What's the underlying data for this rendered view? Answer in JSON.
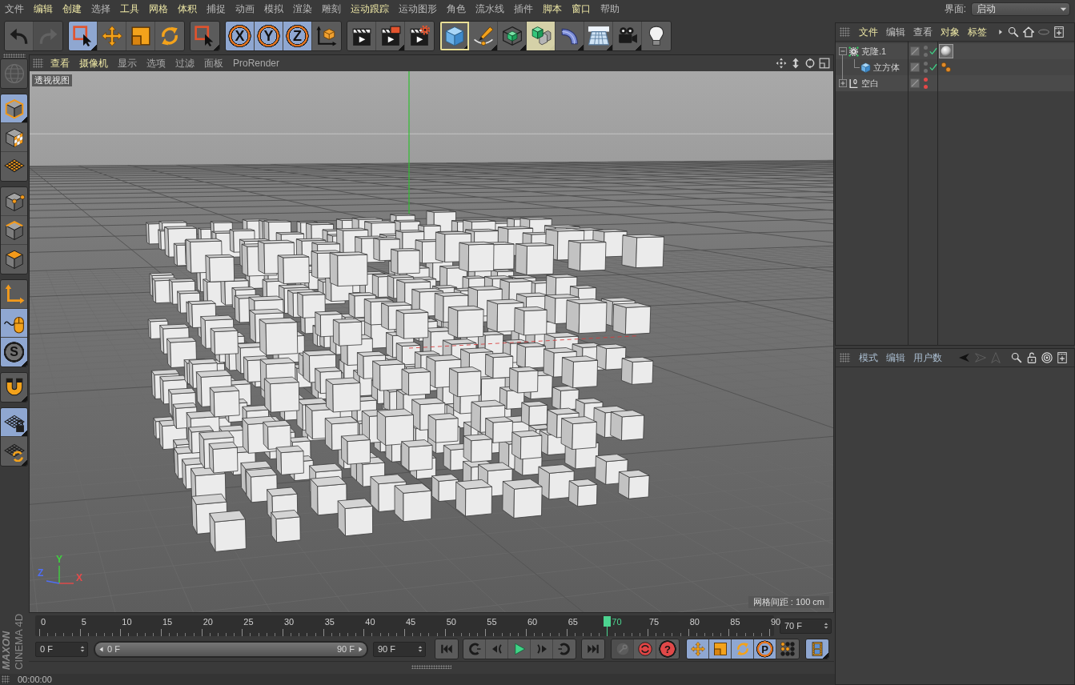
{
  "menu_bar": {
    "items": [
      {
        "label": "文件",
        "highlighted": false
      },
      {
        "label": "编辑",
        "highlighted": true
      },
      {
        "label": "创建",
        "highlighted": true
      },
      {
        "label": "选择",
        "highlighted": false
      },
      {
        "label": "工具",
        "highlighted": true
      },
      {
        "label": "网格",
        "highlighted": true
      },
      {
        "label": "体积",
        "highlighted": true
      },
      {
        "label": "捕捉",
        "highlighted": false
      },
      {
        "label": "动画",
        "highlighted": false
      },
      {
        "label": "模拟",
        "highlighted": false
      },
      {
        "label": "渲染",
        "highlighted": false
      },
      {
        "label": "雕刻",
        "highlighted": false
      },
      {
        "label": "运动跟踪",
        "highlighted": true
      },
      {
        "label": "运动图形",
        "highlighted": false
      },
      {
        "label": "角色",
        "highlighted": false
      },
      {
        "label": "流水线",
        "highlighted": false
      },
      {
        "label": "插件",
        "highlighted": false
      },
      {
        "label": "脚本",
        "highlighted": true
      },
      {
        "label": "窗口",
        "highlighted": true
      },
      {
        "label": "帮助",
        "highlighted": false
      }
    ],
    "layout_label": "界面:",
    "layout_dropdown": "启动"
  },
  "toolbar": {
    "groups": [
      {
        "buttons": [
          {
            "selected": false,
            "disabled": false,
            "focused": false,
            "highlighted": false
          },
          {
            "selected": false,
            "disabled": true,
            "focused": false,
            "highlighted": false
          }
        ]
      },
      {
        "buttons": [
          {
            "selected": true,
            "disabled": false,
            "focused": false,
            "highlighted": false
          },
          {
            "selected": false,
            "disabled": false,
            "focused": false,
            "highlighted": false
          },
          {
            "selected": false,
            "disabled": false,
            "focused": false,
            "highlighted": false
          },
          {
            "selected": false,
            "disabled": false,
            "focused": false,
            "highlighted": false
          }
        ]
      },
      {
        "buttons": [
          {
            "selected": false,
            "disabled": false,
            "focused": false,
            "highlighted": false
          }
        ]
      },
      {
        "buttons": [
          {
            "label": "X",
            "selected": true,
            "disabled": false,
            "focused": false,
            "highlighted": false
          },
          {
            "label": "Y",
            "selected": true,
            "disabled": false,
            "focused": false,
            "highlighted": false
          },
          {
            "label": "Z",
            "selected": true,
            "disabled": false,
            "focused": false,
            "highlighted": false
          },
          {
            "selected": false,
            "disabled": false,
            "focused": false,
            "highlighted": false
          }
        ]
      },
      {
        "buttons": [
          {
            "selected": false,
            "disabled": false,
            "focused": false,
            "highlighted": false
          },
          {
            "selected": false,
            "disabled": false,
            "focused": false,
            "highlighted": false
          },
          {
            "selected": false,
            "disabled": false,
            "focused": false,
            "highlighted": false
          }
        ]
      },
      {
        "buttons": [
          {
            "selected": false,
            "disabled": false,
            "focused": true,
            "highlighted": false
          },
          {
            "selected": false,
            "disabled": false,
            "focused": false,
            "highlighted": false
          },
          {
            "selected": false,
            "disabled": false,
            "focused": false,
            "highlighted": false
          },
          {
            "selected": false,
            "disabled": false,
            "focused": false,
            "highlighted": true
          },
          {
            "selected": false,
            "disabled": false,
            "focused": false,
            "highlighted": false
          },
          {
            "selected": false,
            "disabled": false,
            "focused": false,
            "highlighted": false
          },
          {
            "selected": false,
            "disabled": false,
            "focused": false,
            "highlighted": false
          },
          {
            "selected": false,
            "disabled": false,
            "focused": false,
            "highlighted": false
          }
        ]
      }
    ]
  },
  "left_toolbar": {
    "groups": [
      {
        "buttons": [
          {
            "selected": false,
            "disabled": true
          }
        ]
      },
      {
        "buttons": [
          {
            "selected": true,
            "disabled": false
          },
          {
            "selected": false,
            "disabled": false
          },
          {
            "selected": false,
            "disabled": false
          }
        ]
      },
      {
        "buttons": [
          {
            "selected": false,
            "disabled": false
          },
          {
            "selected": false,
            "disabled": false
          },
          {
            "selected": false,
            "disabled": false
          }
        ]
      },
      {
        "buttons": [
          {
            "selected": false,
            "disabled": false
          },
          {
            "selected": true,
            "disabled": false
          },
          {
            "label": "S",
            "selected": true,
            "disabled": false
          }
        ]
      },
      {
        "buttons": [
          {
            "selected": false,
            "disabled": false
          }
        ]
      },
      {
        "buttons": [
          {
            "selected": true,
            "disabled": false
          },
          {
            "selected": false,
            "disabled": false
          }
        ]
      }
    ]
  },
  "logo": {
    "brand": "MAXON",
    "product": "CINEMA 4D"
  },
  "viewport": {
    "menu": [
      {
        "label": "查看",
        "highlighted": true
      },
      {
        "label": "摄像机",
        "highlighted": true
      },
      {
        "label": "显示",
        "highlighted": false
      },
      {
        "label": "选项",
        "highlighted": false
      },
      {
        "label": "过滤",
        "highlighted": false
      },
      {
        "label": "面板",
        "highlighted": false
      },
      {
        "label": "ProRender",
        "highlighted": false
      }
    ],
    "camera_name": "透视视图",
    "axes": [
      {
        "label": "Y",
        "color": "#3fd13f"
      },
      {
        "label": "Z",
        "color": "#4f6ef5"
      },
      {
        "label": "X",
        "color": "#e84a4a"
      }
    ],
    "grid_spacing": "网格间距 : 100 cm"
  },
  "timeline": {
    "ticks": [
      {
        "label": "0",
        "current": false
      },
      {
        "label": "5",
        "current": false
      },
      {
        "label": "10",
        "current": false
      },
      {
        "label": "15",
        "current": false
      },
      {
        "label": "20",
        "current": false
      },
      {
        "label": "25",
        "current": false
      },
      {
        "label": "30",
        "current": false
      },
      {
        "label": "35",
        "current": false
      },
      {
        "label": "40",
        "current": false
      },
      {
        "label": "45",
        "current": false
      },
      {
        "label": "50",
        "current": false
      },
      {
        "label": "55",
        "current": false
      },
      {
        "label": "60",
        "current": false
      },
      {
        "label": "65",
        "current": false
      },
      {
        "label": "70",
        "current": true
      },
      {
        "label": "75",
        "current": false
      },
      {
        "label": "80",
        "current": false
      },
      {
        "label": "85",
        "current": false
      },
      {
        "label": "90",
        "current": false
      }
    ],
    "current_frame": "70 F"
  },
  "transport": {
    "start_frame": "0 F",
    "range": {
      "start": "0 F",
      "end": "90 F",
      "level": 1
    },
    "end_frame": "90 F",
    "groups": [
      {
        "buttons": [
          {
            "selected": false,
            "disabled": false
          }
        ]
      },
      {
        "buttons": [
          {
            "selected": false,
            "disabled": false
          },
          {
            "selected": false,
            "disabled": false
          },
          {
            "selected": false,
            "disabled": false
          },
          {
            "selected": false,
            "disabled": false
          },
          {
            "selected": false,
            "disabled": false
          }
        ]
      },
      {
        "buttons": [
          {
            "selected": false,
            "disabled": false
          }
        ]
      },
      {
        "buttons": [
          {
            "selected": false,
            "disabled": true
          },
          {
            "selected": false,
            "disabled": false
          },
          {
            "label": "?",
            "selected": false,
            "disabled": false
          }
        ]
      },
      {
        "buttons": [
          {
            "selected": true,
            "disabled": false
          },
          {
            "selected": true,
            "disabled": false
          },
          {
            "selected": true,
            "disabled": false
          },
          {
            "label": "P",
            "selected": true,
            "disabled": false
          },
          {
            "selected": false,
            "disabled": false
          }
        ]
      },
      {
        "buttons": [
          {
            "selected": true,
            "disabled": false
          }
        ]
      }
    ]
  },
  "status_bar": {
    "text": "00:00:00"
  },
  "object_manager": {
    "menu": [
      {
        "label": "文件",
        "highlighted": true
      },
      {
        "label": "编辑",
        "highlighted": false
      },
      {
        "label": "查看",
        "highlighted": false
      },
      {
        "label": "对象",
        "highlighted": true
      },
      {
        "label": "标签",
        "highlighted": true
      }
    ],
    "objects": [
      {
        "name": "克隆.1",
        "kind": "cloner",
        "expanded": true,
        "hidden_in_editor": false,
        "hidden_in_render": false,
        "enabled": true,
        "tags": [
          {
            "kind": "material",
            "selected": true
          }
        ],
        "children": [
          {
            "name": "立方体",
            "kind": "cube",
            "hidden_in_editor": false,
            "hidden_in_render": false,
            "enabled": true,
            "tags": [
              {
                "kind": "selection",
                "selected": false
              }
            ]
          }
        ]
      },
      {
        "name": "空白",
        "kind": "null",
        "expanded": false,
        "hidden_in_editor": true,
        "hidden_in_render": true
      }
    ]
  },
  "attribute_manager": {
    "menu": [
      {
        "label": "模式"
      },
      {
        "label": "编辑"
      },
      {
        "label": "用户数"
      }
    ]
  }
}
